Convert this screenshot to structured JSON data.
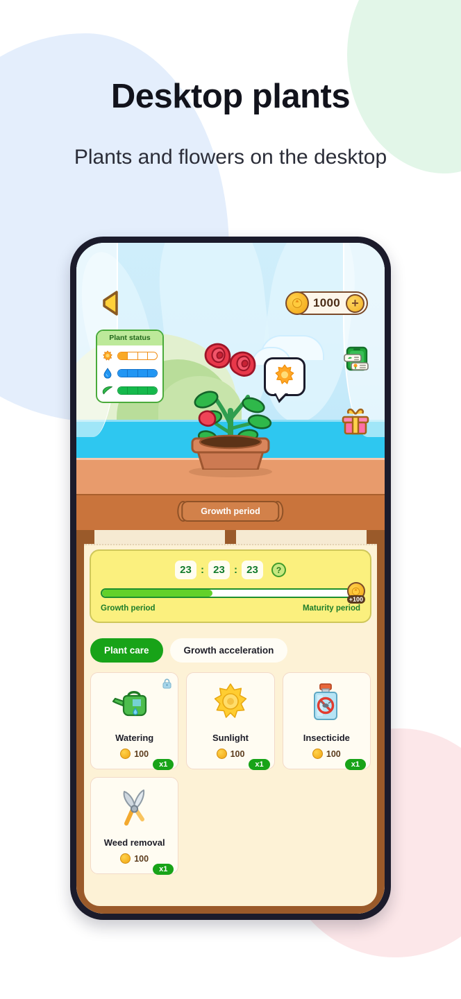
{
  "header": {
    "title": "Desktop plants",
    "subtitle": "Plants and flowers on the desktop"
  },
  "colors": {
    "accent_green": "#18a318",
    "coin_gold": "#f2a415",
    "panel_yellow": "#fbf07e",
    "screen_bg": "#fdf2d6",
    "sky": "#c7ecfa",
    "sea": "#2ec7f0",
    "shelf": "#c9743c",
    "blob_blue": "#e4eefc",
    "blob_green": "#e2f6e8",
    "blob_pink": "#fce7e9"
  },
  "game": {
    "back_label": "back-arrow",
    "currency": {
      "amount": "1000",
      "add_label": "+",
      "icon": "coin-icon"
    },
    "status_panel": {
      "title": "Plant status",
      "rows": [
        {
          "icon": "sun-icon",
          "filled": 1,
          "total": 4,
          "color": "#f9a825"
        },
        {
          "icon": "water-drop-icon",
          "filled": 4,
          "total": 4,
          "color": "#2196f3"
        },
        {
          "icon": "leaf-icon",
          "filled": 4,
          "total": 4,
          "color": "#15b94c"
        }
      ]
    },
    "bubble_icon": "sun-icon",
    "side_icons": [
      {
        "name": "task-list-icon"
      },
      {
        "name": "gift-box-icon"
      }
    ],
    "plant": {
      "name": "rose-plant",
      "pot": "terracotta-pot",
      "blooms": 2,
      "buds": 1
    },
    "sign_label": "Growth period"
  },
  "growth_panel": {
    "timer": {
      "hours": "23",
      "minutes": "23",
      "seconds": "23",
      "separator": ":"
    },
    "help_label": "?",
    "progress_percent": 43,
    "reward": {
      "label": "+100",
      "icon": "coin-icon"
    },
    "left_label": "Growth period",
    "right_label": "Maturity period"
  },
  "tabs": [
    {
      "label": "Plant care",
      "active": true
    },
    {
      "label": "Growth acceleration",
      "active": false
    }
  ],
  "items": [
    {
      "name": "Watering",
      "qty": "x1",
      "price": "100",
      "icon": "watering-can-icon",
      "locked": true
    },
    {
      "name": "Sunlight",
      "qty": "x1",
      "price": "100",
      "icon": "sun-icon",
      "locked": false
    },
    {
      "name": "Insecticide",
      "qty": "x1",
      "price": "100",
      "icon": "insecticide-icon",
      "locked": false
    },
    {
      "name": "Weed removal",
      "qty": "x1",
      "price": "100",
      "icon": "shears-icon",
      "locked": false
    }
  ]
}
